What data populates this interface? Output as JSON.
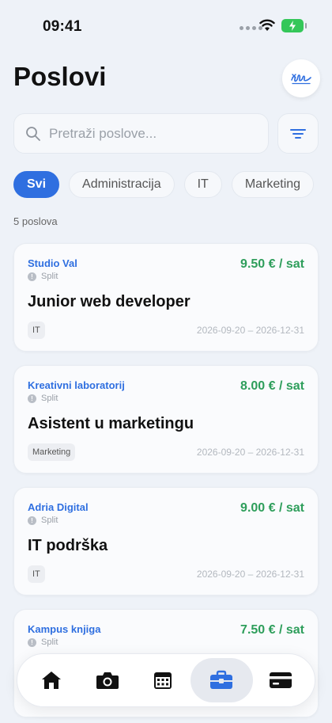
{
  "status_bar": {
    "time": "09:41"
  },
  "header": {
    "title": "Poslovi",
    "profile_icon": "signature-icon"
  },
  "search": {
    "placeholder": "Pretraži poslove..."
  },
  "filters": [
    {
      "label": "Svi",
      "active": true
    },
    {
      "label": "Administracija",
      "active": false
    },
    {
      "label": "IT",
      "active": false
    },
    {
      "label": "Marketing",
      "active": false
    }
  ],
  "job_count": "5 poslova",
  "jobs": [
    {
      "company": "Studio Val",
      "location": "Split",
      "pay": "9.50 € / sat",
      "title": "Junior web developer",
      "tag": "IT",
      "dates": "2026-09-20 – 2026-12-31"
    },
    {
      "company": "Kreativni laboratorij",
      "location": "Split",
      "pay": "8.00 € / sat",
      "title": "Asistent u marketingu",
      "tag": "Marketing",
      "dates": "2026-09-20 – 2026-12-31"
    },
    {
      "company": "Adria Digital",
      "location": "Split",
      "pay": "9.00 € / sat",
      "title": "IT podrška",
      "tag": "IT",
      "dates": "2026-09-20 – 2026-12-31"
    },
    {
      "company": "Kampus knjiga",
      "location": "Split",
      "pay": "7.50 € / sat",
      "title": "",
      "tag": "",
      "dates": ""
    }
  ],
  "tab_bar": [
    {
      "icon": "home-icon",
      "active": false
    },
    {
      "icon": "camera-icon",
      "active": false
    },
    {
      "icon": "calendar-icon",
      "active": false
    },
    {
      "icon": "briefcase-icon",
      "active": true
    },
    {
      "icon": "credit-card-icon",
      "active": false
    }
  ],
  "colors": {
    "accent": "#2f6fe0",
    "pay": "#2e9e5b",
    "background": "#eef2f8"
  }
}
